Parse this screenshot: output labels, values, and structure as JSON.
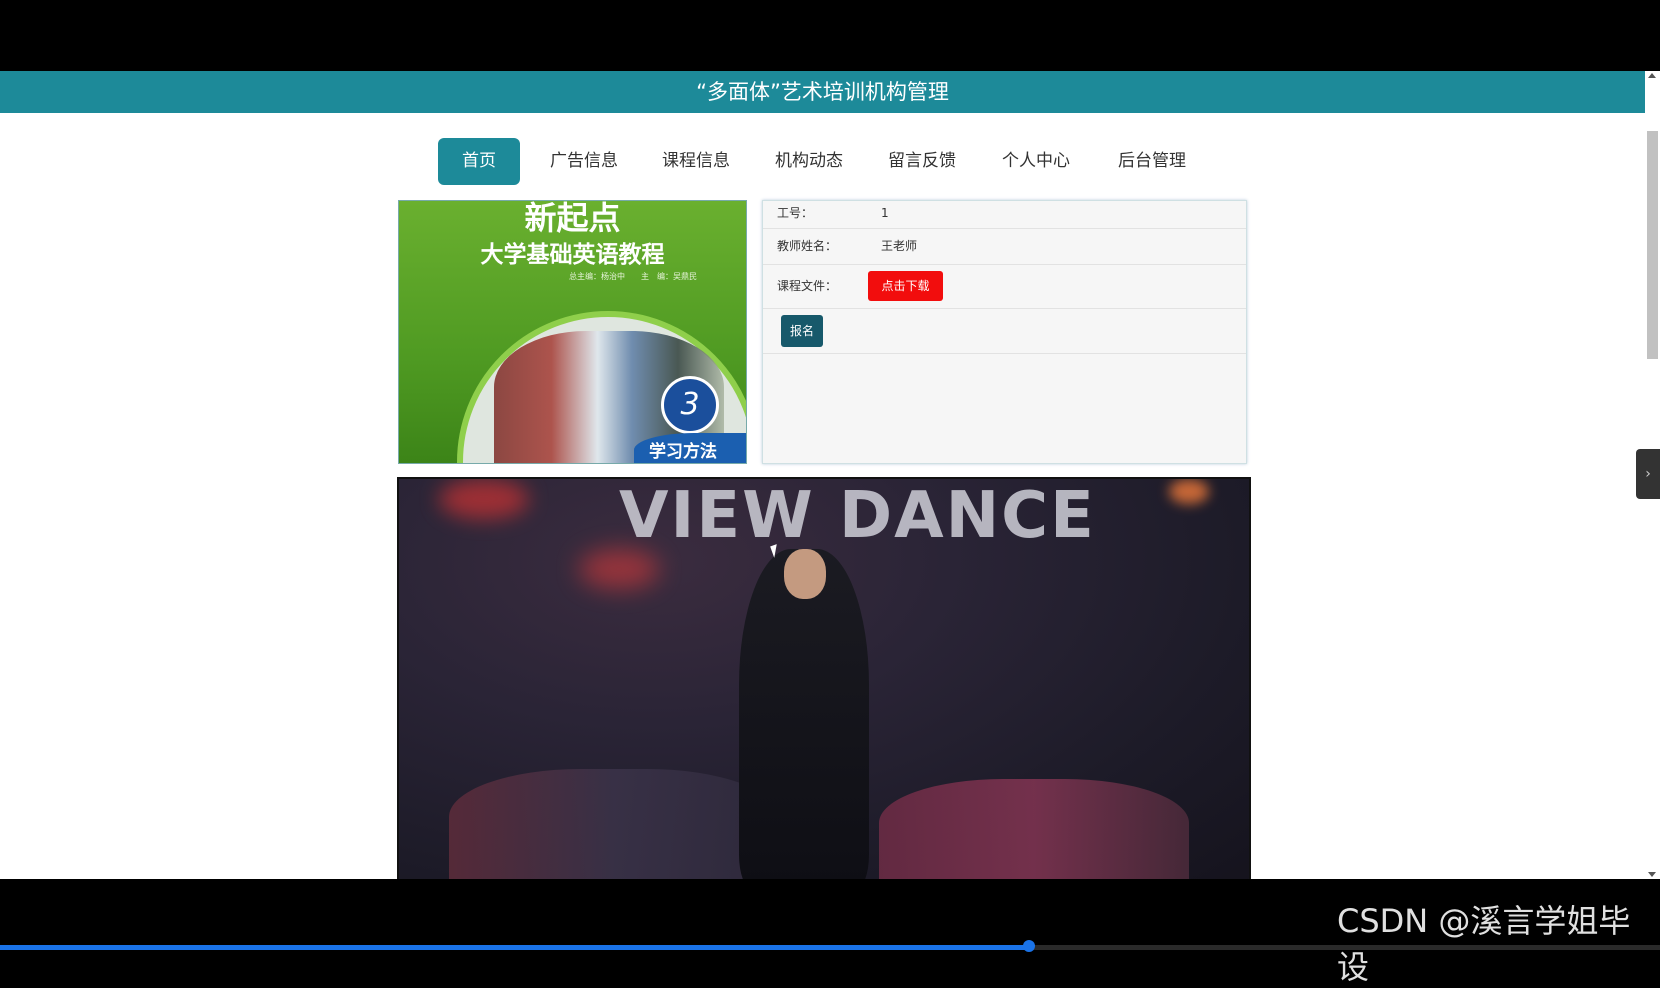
{
  "header": {
    "title": "“多面体”艺术培训机构管理"
  },
  "nav": {
    "items": [
      {
        "label": "首页",
        "active": true
      },
      {
        "label": "广告信息"
      },
      {
        "label": "课程信息"
      },
      {
        "label": "机构动态"
      },
      {
        "label": "留言反馈"
      },
      {
        "label": "个人中心"
      },
      {
        "label": "后台管理"
      }
    ]
  },
  "course_cover": {
    "line1": "新起点",
    "line2": "大学基础英语教程",
    "credits": "总主编：杨治中　　主　编：吴鼎民",
    "badge": "3",
    "study": "学习方法"
  },
  "course_info": {
    "teacher_id_label": "工号：",
    "teacher_id_value": "1",
    "teacher_name_label": "教师姓名：",
    "teacher_name_value": "王老师",
    "course_file_label": "课程文件：",
    "download_button": "点击下载",
    "signup_button": "报名"
  },
  "video": {
    "overlay_text": "VIEW DANCE",
    "progress": 0.62
  },
  "watermark": "CSDN @溪言学姐毕设",
  "colors": {
    "accent": "#1d8a99",
    "download": "#f20d0d",
    "signup": "#17596b"
  }
}
